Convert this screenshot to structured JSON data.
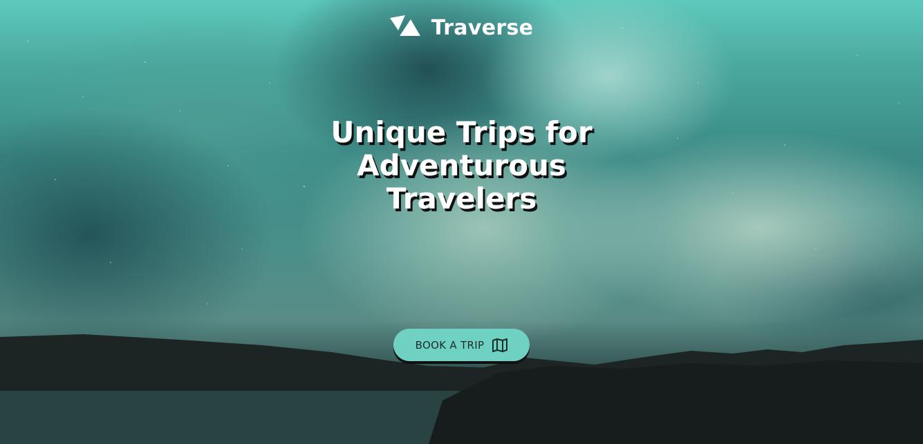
{
  "brand": {
    "name": "Traverse",
    "logo_icon": "traverse-logo-icon"
  },
  "hero": {
    "headline_lines": [
      "Unique Trips for",
      "Adventurous",
      "Travelers"
    ],
    "cta_label": "BOOK A TRIP",
    "cta_icon": "map-icon"
  },
  "colors": {
    "accent": "#6fd1c2",
    "text": "#ffffff",
    "button_text": "#1c2a2a"
  }
}
